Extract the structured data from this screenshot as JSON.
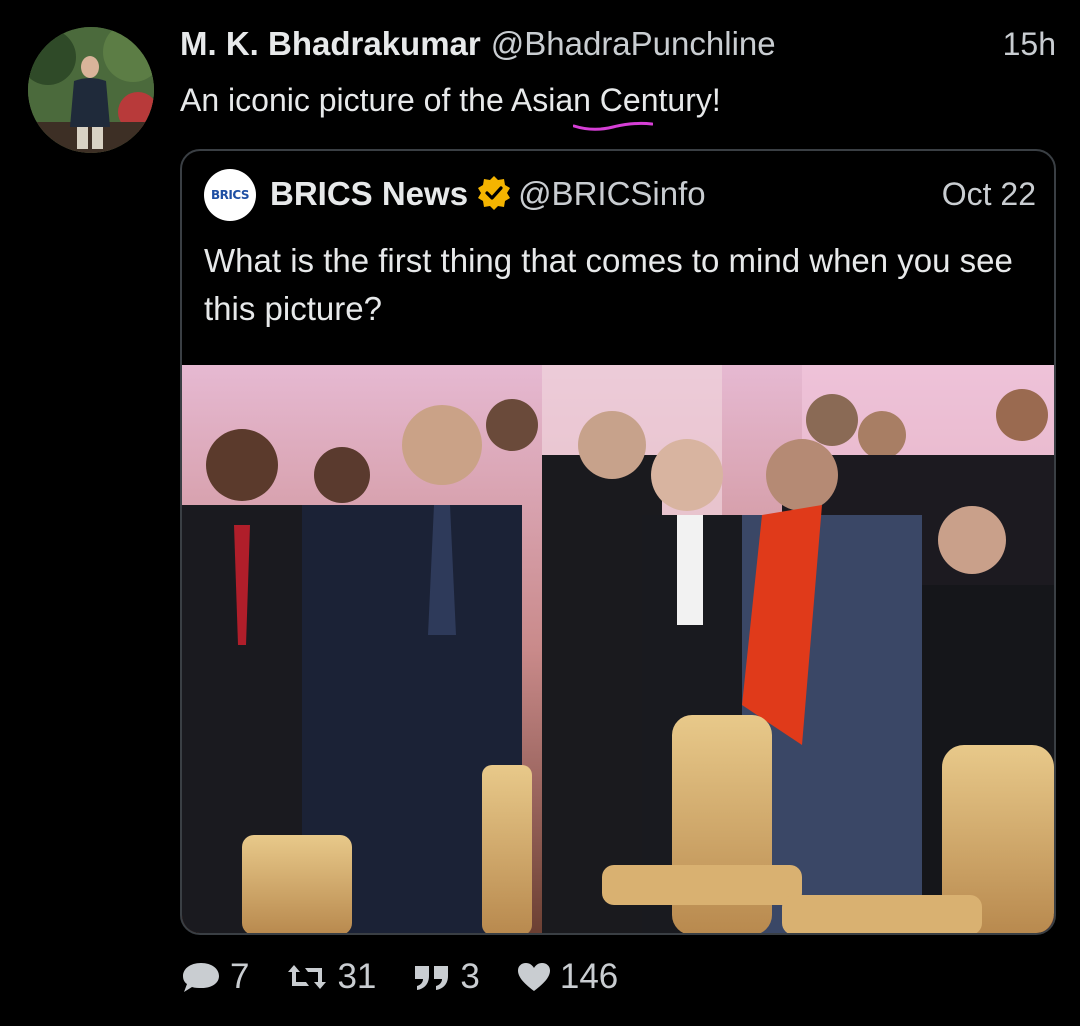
{
  "tweet": {
    "author": {
      "display_name": "M. K. Bhadrakumar",
      "handle": "@BhadraPunchline",
      "avatar_icon": "profile-photo"
    },
    "time": "15h",
    "text": "An iconic picture of the Asian Century!",
    "spellcheck_color": "#d63fd6",
    "quoted": {
      "author": {
        "display_name": "BRICS News",
        "handle": "@BRICSinfo",
        "avatar_label": "BRICS",
        "verified": true,
        "verified_color": "#f4b400"
      },
      "date": "Oct 22",
      "text": "What is the first thing that comes to mind when you see this picture?"
    },
    "actions": {
      "replies": "7",
      "retweets": "31",
      "quotes": "3",
      "likes": "146"
    }
  },
  "colors": {
    "background": "#000000",
    "primary_text": "#e7e9ea",
    "secondary_text": "#c9cdd1",
    "card_border": "#3a3f44"
  }
}
